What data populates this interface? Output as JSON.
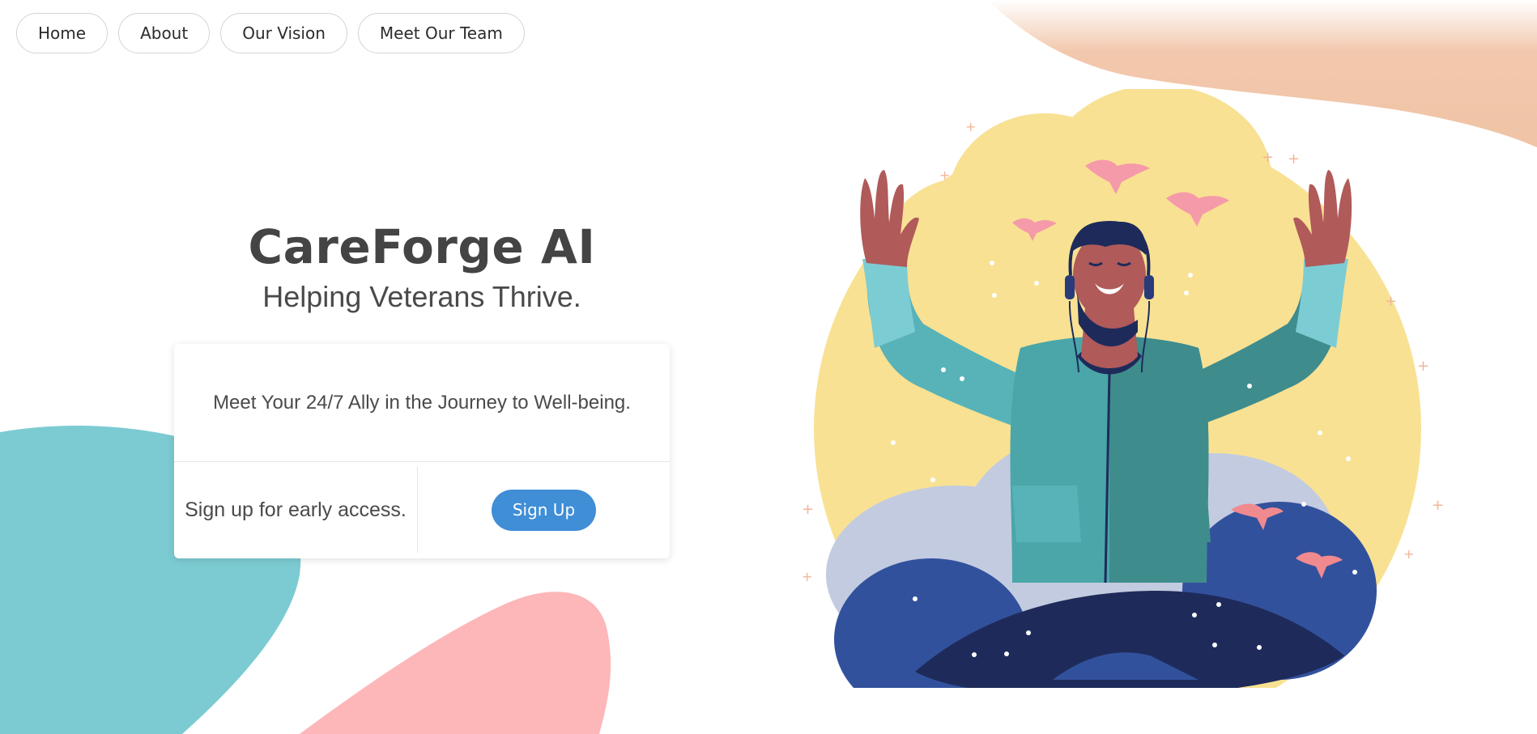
{
  "nav": {
    "items": [
      {
        "label": "Home"
      },
      {
        "label": "About"
      },
      {
        "label": "Our Vision"
      },
      {
        "label": "Meet Our Team"
      }
    ]
  },
  "hero": {
    "title": "CareForge AI",
    "subtitle": "Helping Veterans Thrive."
  },
  "card": {
    "tagline": "Meet Your 24/7 Ally in the Journey to Well-being.",
    "signup_text": "Sign up for early access.",
    "signup_button": "Sign Up"
  },
  "colors": {
    "accent_button": "#3f8ed6",
    "blob_teal": "#7ccbd2",
    "blob_pink": "#fdb7b9",
    "blob_peach": "#f2c8ad",
    "sun_yellow": "#f8e193",
    "jacket_teal": "#4aa6a8",
    "night_navy": "#1e2b5a"
  },
  "illustration": {
    "icon": "veteran-celebrating-illustration"
  }
}
